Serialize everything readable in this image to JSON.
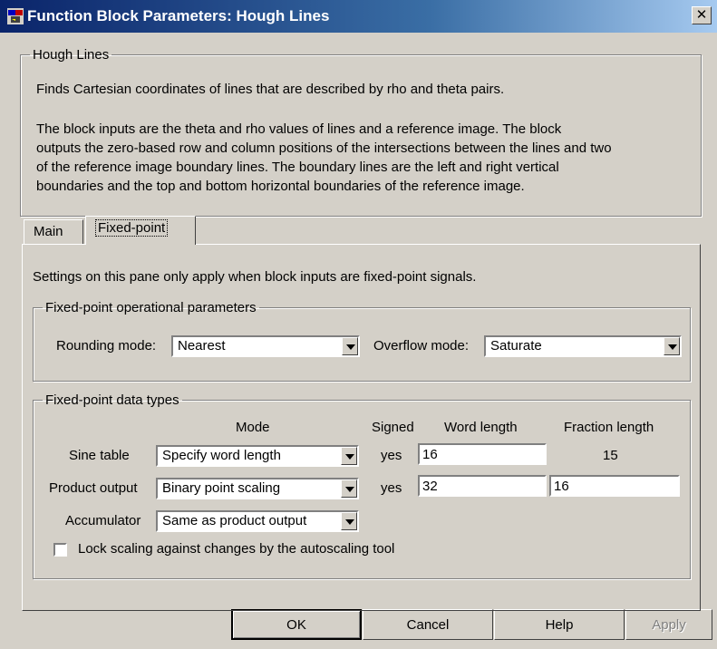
{
  "window": {
    "title": "Function Block Parameters: Hough Lines",
    "close_label": "✕"
  },
  "description": {
    "group_label": "Hough Lines",
    "line1": "Finds Cartesian coordinates of lines that are described by rho and theta pairs.",
    "para2": [
      "The block inputs are the theta and rho values of lines and a reference image. The block",
      "outputs the zero-based row and column positions of the intersections between the lines and two",
      "of the reference image boundary lines. The boundary lines are the left and right vertical",
      "boundaries and the top and bottom horizontal boundaries of the reference image."
    ]
  },
  "tabs": [
    {
      "label": "Main",
      "active": false
    },
    {
      "label": "Fixed-point",
      "active": true
    }
  ],
  "fixed_point": {
    "note": "Settings on this pane only apply when block inputs are fixed-point signals.",
    "operational": {
      "group_label": "Fixed-point operational parameters",
      "rounding_label": "Rounding mode:",
      "rounding_value": "Nearest",
      "overflow_label": "Overflow mode:",
      "overflow_value": "Saturate"
    },
    "data_types": {
      "group_label": "Fixed-point data types",
      "headers": {
        "mode": "Mode",
        "signed": "Signed",
        "word_length": "Word length",
        "fraction_length": "Fraction length"
      },
      "rows": [
        {
          "label": "Sine table",
          "mode": "Specify word length",
          "signed": "yes",
          "word_length": "16",
          "fraction_length": "15"
        },
        {
          "label": "Product output",
          "mode": "Binary point scaling",
          "signed": "yes",
          "word_length": "32",
          "fraction_length": "16"
        },
        {
          "label": "Accumulator",
          "mode": "Same as product output"
        }
      ],
      "lock_label": "Lock scaling against changes by the autoscaling tool",
      "lock_checked": false
    }
  },
  "buttons": {
    "ok": "OK",
    "cancel": "Cancel",
    "help": "Help",
    "apply": "Apply"
  }
}
